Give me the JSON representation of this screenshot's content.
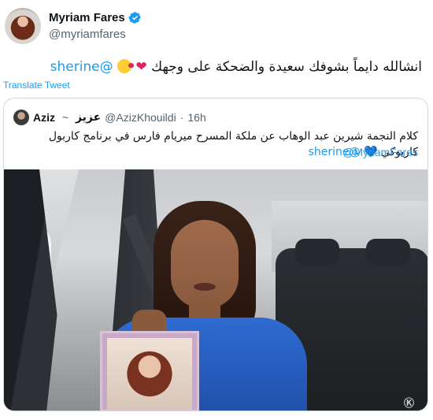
{
  "author": {
    "display_name": "Myriam Fares",
    "handle": "@myriamfares",
    "verified": true
  },
  "tweet": {
    "mention": "@sherine",
    "text": "انشالله دايماً بشوفك سعيدة والضحكة على وجهك",
    "heart": "❤",
    "emoji_icon": "kissing-face-icon"
  },
  "translate_label": "Translate Tweet",
  "quoted_tweet": {
    "name": "Aziz",
    "separator": " ~ ",
    "name_arabic": "عزيز",
    "handle": "@AzizKhouildi",
    "dot": "·",
    "time": "16h",
    "text": "كلام النجمة شيرين عبد الوهاب عن ملكة المسرح ميريام فارس في برنامج كاربول كاريوكي",
    "mention1": "@sherine",
    "blue_heart": "💙",
    "mention2": "@MyriamFares"
  },
  "video": {
    "watermark": "Ⓚ"
  },
  "colors": {
    "link_blue": "#1d9bf0",
    "secondary_text": "#536471",
    "border": "#cfd9de",
    "verified_blue": "#1d9bf0",
    "heart_red": "#e0245e"
  }
}
